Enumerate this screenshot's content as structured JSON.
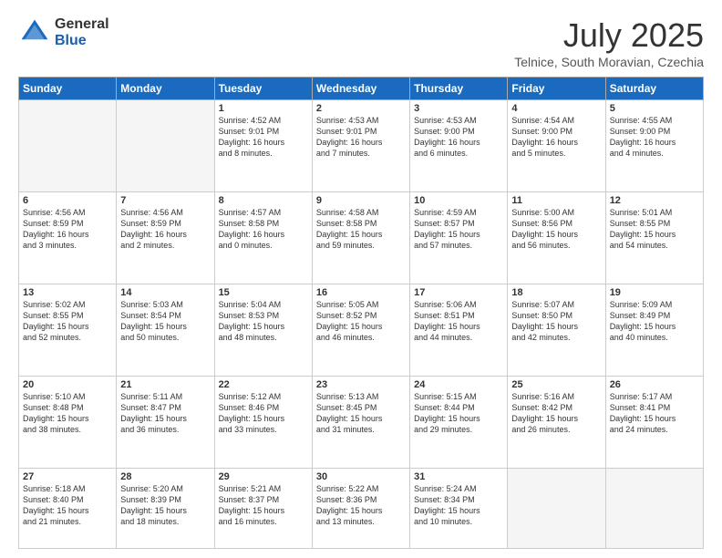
{
  "logo": {
    "general": "General",
    "blue": "Blue"
  },
  "header": {
    "month": "July 2025",
    "location": "Telnice, South Moravian, Czechia"
  },
  "weekdays": [
    "Sunday",
    "Monday",
    "Tuesday",
    "Wednesday",
    "Thursday",
    "Friday",
    "Saturday"
  ],
  "weeks": [
    [
      {
        "day": "",
        "info": ""
      },
      {
        "day": "",
        "info": ""
      },
      {
        "day": "1",
        "info": "Sunrise: 4:52 AM\nSunset: 9:01 PM\nDaylight: 16 hours\nand 8 minutes."
      },
      {
        "day": "2",
        "info": "Sunrise: 4:53 AM\nSunset: 9:01 PM\nDaylight: 16 hours\nand 7 minutes."
      },
      {
        "day": "3",
        "info": "Sunrise: 4:53 AM\nSunset: 9:00 PM\nDaylight: 16 hours\nand 6 minutes."
      },
      {
        "day": "4",
        "info": "Sunrise: 4:54 AM\nSunset: 9:00 PM\nDaylight: 16 hours\nand 5 minutes."
      },
      {
        "day": "5",
        "info": "Sunrise: 4:55 AM\nSunset: 9:00 PM\nDaylight: 16 hours\nand 4 minutes."
      }
    ],
    [
      {
        "day": "6",
        "info": "Sunrise: 4:56 AM\nSunset: 8:59 PM\nDaylight: 16 hours\nand 3 minutes."
      },
      {
        "day": "7",
        "info": "Sunrise: 4:56 AM\nSunset: 8:59 PM\nDaylight: 16 hours\nand 2 minutes."
      },
      {
        "day": "8",
        "info": "Sunrise: 4:57 AM\nSunset: 8:58 PM\nDaylight: 16 hours\nand 0 minutes."
      },
      {
        "day": "9",
        "info": "Sunrise: 4:58 AM\nSunset: 8:58 PM\nDaylight: 15 hours\nand 59 minutes."
      },
      {
        "day": "10",
        "info": "Sunrise: 4:59 AM\nSunset: 8:57 PM\nDaylight: 15 hours\nand 57 minutes."
      },
      {
        "day": "11",
        "info": "Sunrise: 5:00 AM\nSunset: 8:56 PM\nDaylight: 15 hours\nand 56 minutes."
      },
      {
        "day": "12",
        "info": "Sunrise: 5:01 AM\nSunset: 8:55 PM\nDaylight: 15 hours\nand 54 minutes."
      }
    ],
    [
      {
        "day": "13",
        "info": "Sunrise: 5:02 AM\nSunset: 8:55 PM\nDaylight: 15 hours\nand 52 minutes."
      },
      {
        "day": "14",
        "info": "Sunrise: 5:03 AM\nSunset: 8:54 PM\nDaylight: 15 hours\nand 50 minutes."
      },
      {
        "day": "15",
        "info": "Sunrise: 5:04 AM\nSunset: 8:53 PM\nDaylight: 15 hours\nand 48 minutes."
      },
      {
        "day": "16",
        "info": "Sunrise: 5:05 AM\nSunset: 8:52 PM\nDaylight: 15 hours\nand 46 minutes."
      },
      {
        "day": "17",
        "info": "Sunrise: 5:06 AM\nSunset: 8:51 PM\nDaylight: 15 hours\nand 44 minutes."
      },
      {
        "day": "18",
        "info": "Sunrise: 5:07 AM\nSunset: 8:50 PM\nDaylight: 15 hours\nand 42 minutes."
      },
      {
        "day": "19",
        "info": "Sunrise: 5:09 AM\nSunset: 8:49 PM\nDaylight: 15 hours\nand 40 minutes."
      }
    ],
    [
      {
        "day": "20",
        "info": "Sunrise: 5:10 AM\nSunset: 8:48 PM\nDaylight: 15 hours\nand 38 minutes."
      },
      {
        "day": "21",
        "info": "Sunrise: 5:11 AM\nSunset: 8:47 PM\nDaylight: 15 hours\nand 36 minutes."
      },
      {
        "day": "22",
        "info": "Sunrise: 5:12 AM\nSunset: 8:46 PM\nDaylight: 15 hours\nand 33 minutes."
      },
      {
        "day": "23",
        "info": "Sunrise: 5:13 AM\nSunset: 8:45 PM\nDaylight: 15 hours\nand 31 minutes."
      },
      {
        "day": "24",
        "info": "Sunrise: 5:15 AM\nSunset: 8:44 PM\nDaylight: 15 hours\nand 29 minutes."
      },
      {
        "day": "25",
        "info": "Sunrise: 5:16 AM\nSunset: 8:42 PM\nDaylight: 15 hours\nand 26 minutes."
      },
      {
        "day": "26",
        "info": "Sunrise: 5:17 AM\nSunset: 8:41 PM\nDaylight: 15 hours\nand 24 minutes."
      }
    ],
    [
      {
        "day": "27",
        "info": "Sunrise: 5:18 AM\nSunset: 8:40 PM\nDaylight: 15 hours\nand 21 minutes."
      },
      {
        "day": "28",
        "info": "Sunrise: 5:20 AM\nSunset: 8:39 PM\nDaylight: 15 hours\nand 18 minutes."
      },
      {
        "day": "29",
        "info": "Sunrise: 5:21 AM\nSunset: 8:37 PM\nDaylight: 15 hours\nand 16 minutes."
      },
      {
        "day": "30",
        "info": "Sunrise: 5:22 AM\nSunset: 8:36 PM\nDaylight: 15 hours\nand 13 minutes."
      },
      {
        "day": "31",
        "info": "Sunrise: 5:24 AM\nSunset: 8:34 PM\nDaylight: 15 hours\nand 10 minutes."
      },
      {
        "day": "",
        "info": ""
      },
      {
        "day": "",
        "info": ""
      }
    ]
  ]
}
